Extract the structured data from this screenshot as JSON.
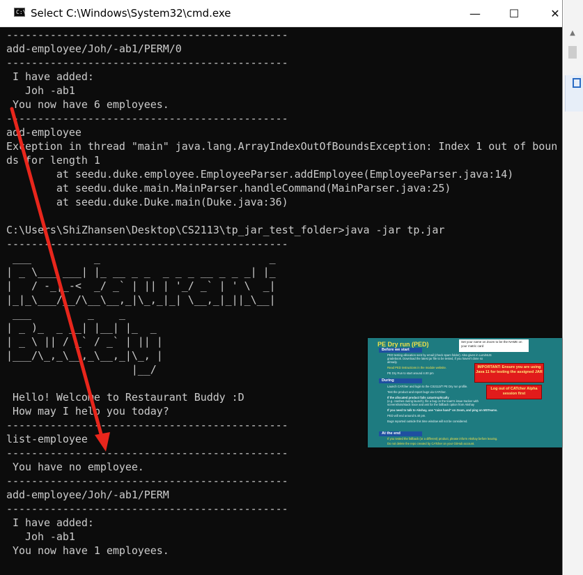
{
  "window": {
    "title": "Select C:\\Windows\\System32\\cmd.exe",
    "app_icon_text": "C:\\",
    "minimize_glyph": "—",
    "maximize_glyph": "☐",
    "close_glyph": "✕"
  },
  "console": {
    "lines": [
      "---------------------------------------------",
      "add-employee/Joh/-ab1/PERM/0",
      "---------------------------------------------",
      " I have added:",
      "   Joh -ab1",
      " You now have 6 employees.",
      "---------------------------------------------",
      "add-employee",
      "Exception in thread \"main\" java.lang.ArrayIndexOutOfBoundsException: Index 1 out of boun",
      "ds for length 1",
      "        at seedu.duke.employee.EmployeeParser.addEmployee(EmployeeParser.java:14)",
      "        at seedu.duke.main.MainParser.handleCommand(MainParser.java:25)",
      "        at seedu.duke.Duke.main(Duke.java:36)",
      "",
      "C:\\Users\\ShiZhansen\\Desktop\\CS2113\\tp_jar_test_folder>java -jar tp.jar",
      "---------------------------------------------",
      " ___          _                           _",
      "| _ \\___ ___| |_ __ _ _  _ _ _ __ _ _ _| |_",
      "|   / -_|_-<  _/ _` | || | '_/ _` | ' \\  _|",
      "|_|_\\___/__/\\__\\__,_|\\_,_|_| \\__,_|_||_\\__|",
      " ___         _    _",
      "| _ )_  _ __| |__| |_  _",
      "| _ \\ || / _` / _` | || |",
      "|___/\\_,_\\__,_\\__,_|\\_, |",
      "                    |__/",
      "",
      " Hello! Welcome to Restaurant Buddy :D",
      " How may I help you today?",
      "---------------------------------------------",
      "list-employee",
      "---------------------------------------------",
      " You have no employee.",
      "---------------------------------------------",
      "add-employee/Joh/-ab1/PERM",
      "---------------------------------------------",
      " I have added:",
      "   Joh -ab1",
      " You now have 1 employees."
    ]
  },
  "slide_thumbnail": {
    "title": "PE Dry run (PED)",
    "zoom_note": "Set your name on Zoom to be the NAME on your matric card",
    "sections": [
      "Before we start",
      "During",
      "At the end"
    ],
    "before_bullets": [
      "PED testing allocation sent by email (check spam folder). Also given in LumiNUS",
      "gradebook. Download the latest jar file to be tested, if you haven't done so",
      "already.",
      "Read PED instructions in the module website.",
      "PE Dry Run to start around 4.00 pm"
    ],
    "during_bullets": [
      "Launch CATcher and login to the CS2113/T PE Dry run profile.",
      "Test the product and report bugs via CATcher.",
      "If the allocated product fails catastrophically",
      "(e.g. crashes during launch), file a bug on the team's issue tracker with",
      "screenshots/stack trace and ask for the fallback option from Akshay",
      "If you need to talk to Akshay, use \"raise hand\" on Zoom, and ping on MSTeams.",
      "PED will end around 5.40 pm.",
      "Bugs reported outside this time window will not be considered."
    ],
    "end_bullets": [
      "If you tested the fallback (or a different) product, please inform Akshay before leaving.",
      "Do not delete the repo created by CATcher on your GitHub account."
    ],
    "red_box_1": "IMPORTANT: Ensure you are using Java 11 for testing the assigned JAR",
    "red_box_2": "Log out of CATcher Alpha session first"
  },
  "colors": {
    "console_bg": "#0c0c0c",
    "console_fg": "#cccccc",
    "annotation_arrow": "#e8261c",
    "slide_bg": "#1e7b80"
  }
}
